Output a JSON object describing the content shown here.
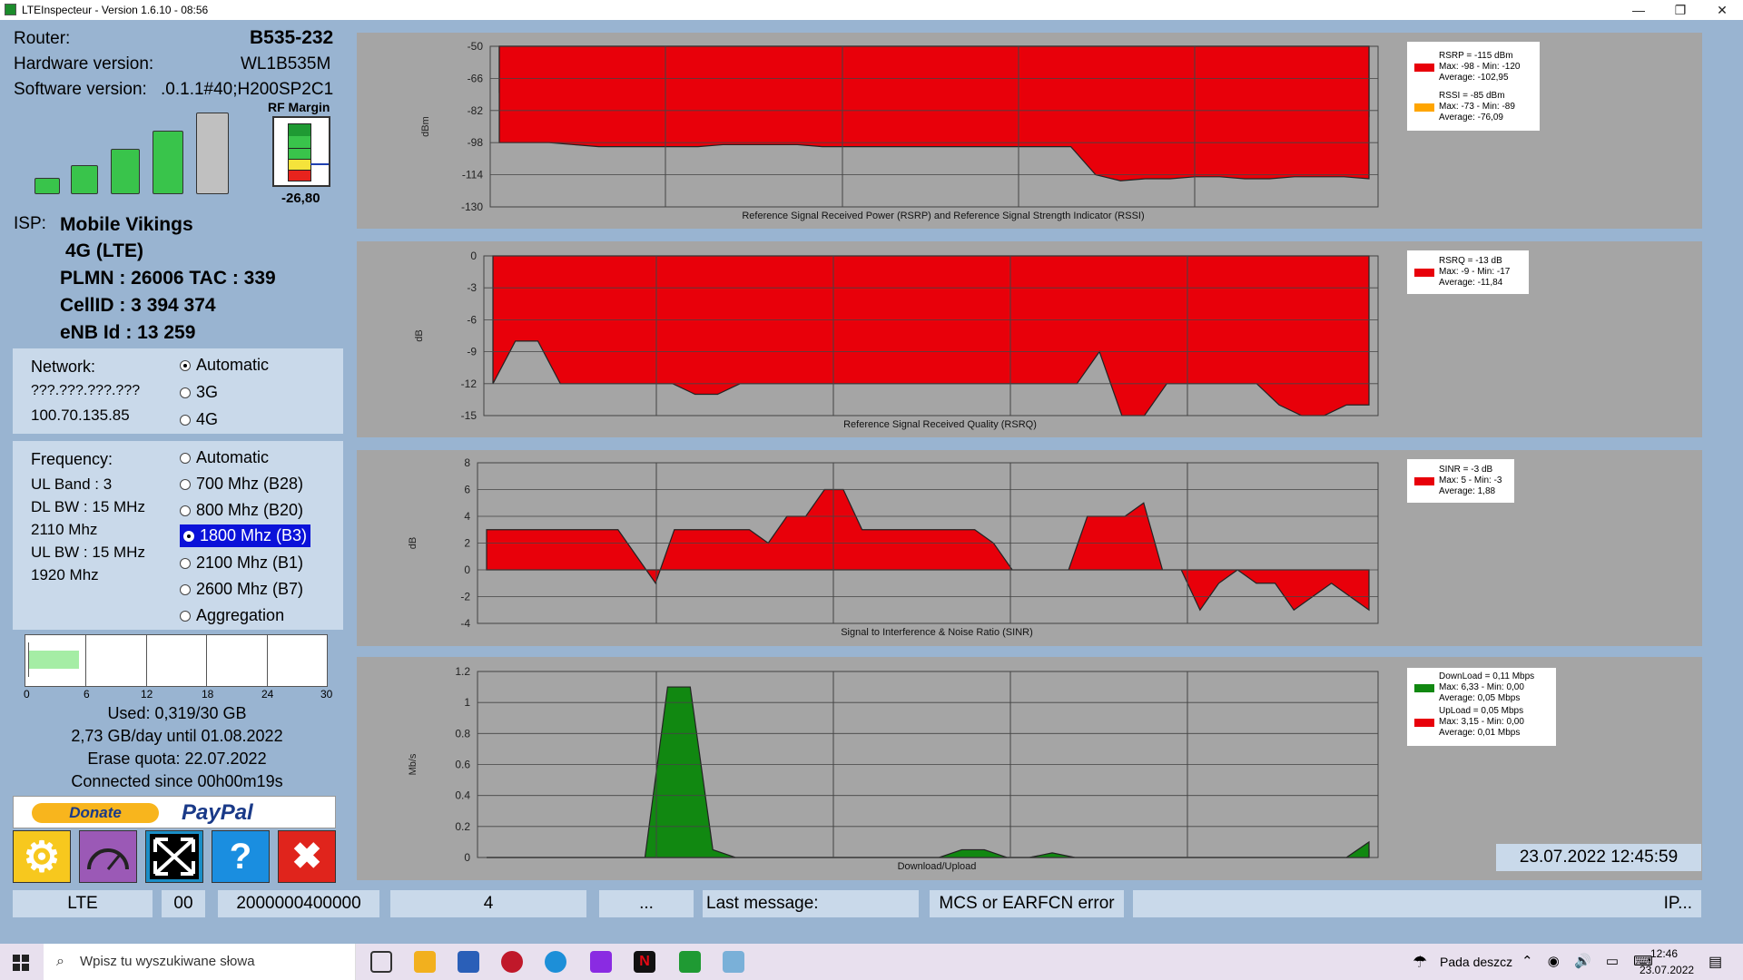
{
  "window": {
    "title": "LTEInspecteur - Version 1.6.10 - 08:56"
  },
  "router": {
    "router_label": "Router:",
    "router_value": "B535-232",
    "hw_label": "Hardware version:",
    "hw_value": "WL1B535M",
    "sw_label": "Software version:",
    "sw_value": ".0.1.1#40;H200SP2C1"
  },
  "rf": {
    "label": "RF Margin",
    "value": "-26,80"
  },
  "signal_bars": {
    "level": 4,
    "max": 5
  },
  "isp": {
    "label": "ISP:",
    "name": "Mobile Vikings",
    "tech": "4G (LTE)",
    "plmn": "PLMN : 26006 TAC : 339",
    "cellid": "CellID : 3 394 374",
    "enb": "eNB Id : 13 259"
  },
  "network": {
    "label": "Network:",
    "ip1": "???.???.???.???",
    "ip2": "100.70.135.85",
    "options": [
      "Automatic",
      "3G",
      "4G"
    ],
    "selected": 0
  },
  "frequency": {
    "label": "Frequency:",
    "ul_band": "UL Band : 3",
    "dl_bw": "DL BW : 15 MHz",
    "dl_freq": "2110 Mhz",
    "ul_bw": "UL BW : 15 MHz",
    "ul_freq": "1920 Mhz",
    "options": [
      "Automatic",
      "700 Mhz (B28)",
      "800 Mhz (B20)",
      "1800 Mhz (B3)",
      "2100 Mhz (B1)",
      "2600 Mhz (B7)",
      "Aggregation"
    ],
    "selected": 3
  },
  "quota": {
    "ticks": [
      "0",
      "6",
      "12",
      "18",
      "24",
      "30"
    ],
    "used_fraction": 0.17,
    "used": "Used: 0,319/30 GB",
    "per_day": "2,73 GB/day until 01.08.2022",
    "erase": "Erase quota: 22.07.2022",
    "connected": "Connected since 00h00m19s"
  },
  "donate": {
    "button": "Donate",
    "brand": "PayPal"
  },
  "toolbar": {
    "help": "?",
    "close": "✖"
  },
  "legends": {
    "rsrp": {
      "l1": "RSRP = -115 dBm",
      "l2": "Max: -98 - Min: -120",
      "l3": "Average: -102,95",
      "l4": "RSSI = -85 dBm",
      "l5": "Max: -73 - Min: -89",
      "l6": "Average: -76,09"
    },
    "rsrq": {
      "l1": "RSRQ = -13 dB",
      "l2": "Max: -9 - Min: -17",
      "l3": "Average: -11,84"
    },
    "sinr": {
      "l1": "SINR = -3 dB",
      "l2": "Max: 5 - Min: -3",
      "l3": "Average: 1,88"
    },
    "dl": {
      "l1": "DownLoad = 0,11 Mbps",
      "l2": "Max: 6,33 - Min: 0,00",
      "l3": "Average: 0,05 Mbps",
      "l4": "UpLoad = 0,05 Mbps",
      "l5": "Max: 3,15 - Min: 0,00",
      "l6": "Average: 0,01 Mbps"
    }
  },
  "chart_data": [
    {
      "type": "area",
      "title": "Reference Signal Received Power (RSRP) and Reference Signal Strength Indicator (RSSI)",
      "ylabel": "dBm",
      "yticks": [
        "-50",
        "-66",
        "-82",
        "-98",
        "-114",
        "-130"
      ],
      "ylim": [
        -130,
        -50
      ],
      "series": [
        {
          "name": "RSRP",
          "values": [
            -98,
            -98,
            -98,
            -99,
            -100,
            -100,
            -100,
            -100,
            -100,
            -99,
            -99,
            -99,
            -99,
            -100,
            -100,
            -100,
            -100,
            -100,
            -100,
            -100,
            -100,
            -100,
            -100,
            -100,
            -114,
            -117,
            -116,
            -116,
            -115,
            -115,
            -116,
            -116,
            -115,
            -115,
            -115,
            -116
          ]
        },
        {
          "name": "RSSI",
          "values": [
            -73,
            -73,
            -73,
            -73,
            -74,
            -74,
            -74,
            -74,
            -74,
            -74,
            -74,
            -74,
            -74,
            -74,
            -74,
            -74,
            -74,
            -74,
            -74,
            -74,
            -74,
            -74,
            -74,
            -74,
            -85,
            -88,
            -87,
            -87,
            -86,
            -86,
            -86,
            -86,
            -86,
            -86,
            -86,
            -85
          ]
        }
      ]
    },
    {
      "type": "area",
      "title": "Reference Signal Received Quality (RSRQ)",
      "ylabel": "dB",
      "yticks": [
        "0",
        "-3",
        "-6",
        "-9",
        "-12",
        "-15"
      ],
      "ylim": [
        -15,
        0
      ],
      "series": [
        {
          "name": "RSRQ",
          "values": [
            -12,
            -8,
            -8,
            -12,
            -12,
            -12,
            -12,
            -12,
            -12,
            -13,
            -13,
            -12,
            -12,
            -12,
            -12,
            -12,
            -12,
            -12,
            -12,
            -12,
            -12,
            -12,
            -12,
            -12,
            -12,
            -12,
            -12,
            -9,
            -15,
            -15,
            -12,
            -12,
            -12,
            -12,
            -12,
            -14,
            -15,
            -15,
            -14,
            -14
          ]
        }
      ]
    },
    {
      "type": "area",
      "title": "Signal to Interference & Noise Ratio (SINR)",
      "ylabel": "dB",
      "yticks": [
        "8",
        "6",
        "4",
        "2",
        "0",
        "-2",
        "-4"
      ],
      "ylim": [
        -4,
        8
      ],
      "series": [
        {
          "name": "SINR",
          "values": [
            3,
            3,
            3,
            3,
            3,
            3,
            3,
            3,
            1,
            -1,
            3,
            3,
            3,
            3,
            3,
            2,
            4,
            4,
            6,
            6,
            3,
            3,
            3,
            3,
            3,
            3,
            3,
            2,
            0,
            0,
            0,
            0,
            4,
            4,
            4,
            5,
            0,
            0,
            -3,
            -1,
            0,
            -1,
            -1,
            -3,
            -2,
            -1,
            -2,
            -3
          ]
        }
      ]
    },
    {
      "type": "area",
      "title": "Download/Upload",
      "ylabel": "Mb/s",
      "yticks": [
        "1.2",
        "1",
        "0.8",
        "0.6",
        "0.4",
        "0.2",
        "0"
      ],
      "ylim": [
        0,
        1.2
      ],
      "series": [
        {
          "name": "DownLoad",
          "values": [
            0,
            0,
            0,
            0,
            0,
            0,
            0,
            0,
            1.1,
            1.1,
            0.05,
            0,
            0,
            0,
            0,
            0,
            0,
            0,
            0,
            0,
            0,
            0.05,
            0.05,
            0,
            0,
            0.03,
            0,
            0,
            0,
            0,
            0,
            0,
            0,
            0,
            0,
            0,
            0,
            0,
            0,
            0.1
          ]
        },
        {
          "name": "UpLoad",
          "values": [
            0,
            0,
            0,
            0,
            0,
            0,
            0,
            0,
            0.3,
            0.3,
            0.02,
            0,
            0,
            0,
            0,
            0,
            0,
            0,
            0,
            0,
            0,
            0.02,
            0.02,
            0,
            0,
            0.02,
            0,
            0,
            0,
            0,
            0,
            0,
            0,
            0,
            0,
            0,
            0,
            0,
            0,
            0.05
          ]
        }
      ]
    }
  ],
  "datetime": "23.07.2022 12:45:59",
  "status": {
    "mode": "LTE",
    "code": "00",
    "id": "2000000400000",
    "num": "4",
    "dots": "...",
    "last": "Last message:",
    "err": "MCS or EARFCN error",
    "ip": "IP..."
  },
  "taskbar": {
    "search": "Wpisz tu wyszukiwane słowa",
    "weather": "Pada deszcz",
    "time": "12:46",
    "date": "23.07.2022"
  }
}
